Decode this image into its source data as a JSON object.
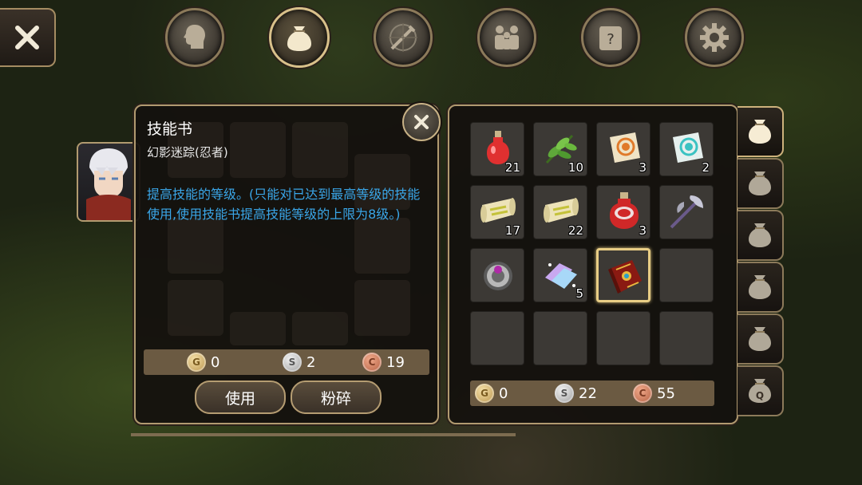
{
  "top_tabs": [
    {
      "icon": "head-profile-icon",
      "active": false
    },
    {
      "icon": "bag-icon",
      "active": true
    },
    {
      "icon": "compass-sword-icon",
      "active": false
    },
    {
      "icon": "people-icon",
      "active": false
    },
    {
      "icon": "quest-scroll-icon",
      "active": false
    },
    {
      "icon": "gear-icon",
      "active": false
    }
  ],
  "detail": {
    "title": "技能书",
    "subtitle": "幻影迷踪(忍者)",
    "description": "提高技能的等级。(只能对已达到最高等级的技能使用,使用技能书提高技能等级的上限为8级。)",
    "money": {
      "gold": "0",
      "silver": "2",
      "copper": "19"
    },
    "use_label": "使用",
    "crush_label": "粉碎"
  },
  "inventory": {
    "slots": [
      {
        "item": "red-potion",
        "qty": "21"
      },
      {
        "item": "green-herb",
        "qty": "10"
      },
      {
        "item": "orange-map-scroll",
        "qty": "3"
      },
      {
        "item": "blue-map-scroll",
        "qty": "2"
      },
      {
        "item": "yellow-scroll",
        "qty": "17"
      },
      {
        "item": "yellow-scroll",
        "qty": "22"
      },
      {
        "item": "large-red-potion",
        "qty": "3"
      },
      {
        "item": "battle-axe",
        "qty": ""
      },
      {
        "item": "purple-gem-ring",
        "qty": ""
      },
      {
        "item": "crystal-shards",
        "qty": "5"
      },
      {
        "item": "skill-book",
        "qty": "",
        "selected": true
      },
      {
        "item": "",
        "qty": ""
      },
      {
        "item": "",
        "qty": ""
      },
      {
        "item": "",
        "qty": ""
      },
      {
        "item": "",
        "qty": ""
      },
      {
        "item": "",
        "qty": ""
      }
    ],
    "money": {
      "gold": "0",
      "silver": "22",
      "copper": "55"
    }
  },
  "coin_letters": {
    "gold": "G",
    "silver": "S",
    "copper": "C"
  },
  "side_tabs": [
    {
      "icon": "bag-icon",
      "active": true
    },
    {
      "icon": "bag-icon",
      "active": false
    },
    {
      "icon": "bag-icon",
      "active": false
    },
    {
      "icon": "bag-icon",
      "active": false
    },
    {
      "icon": "bag-icon",
      "active": false
    },
    {
      "icon": "quest-bag-icon",
      "label": "Q",
      "active": false
    }
  ],
  "colors": {
    "accent": "#d8c08a",
    "description": "#3aa6e8",
    "panel": "#14110e"
  }
}
